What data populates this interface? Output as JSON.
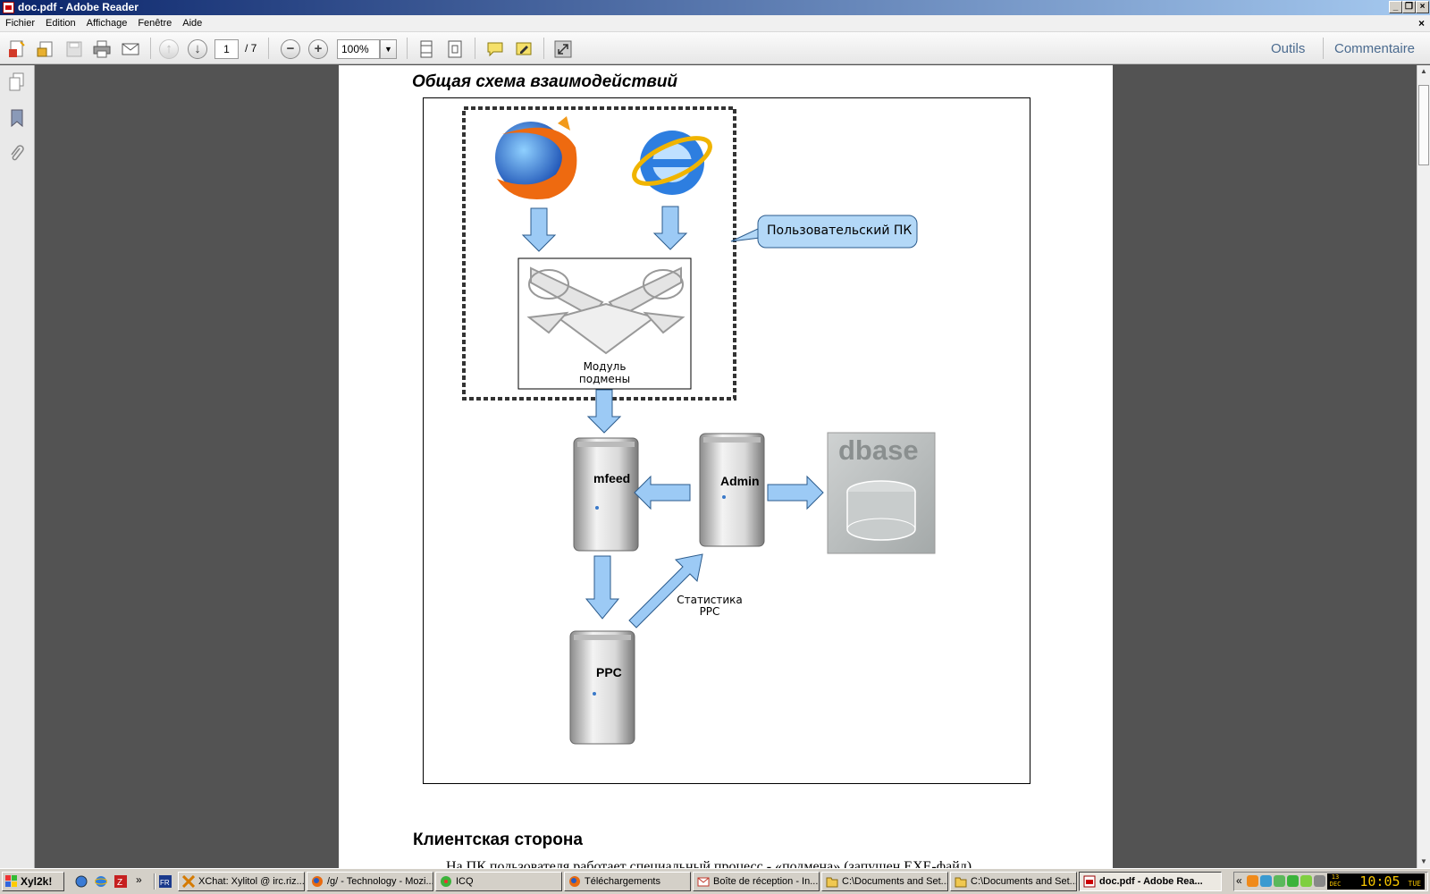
{
  "window": {
    "title": "doc.pdf - Adobe Reader"
  },
  "menu": [
    "Fichier",
    "Edition",
    "Affichage",
    "Fenêtre",
    "Aide"
  ],
  "toolbar": {
    "page_current": "1",
    "page_total": "/ 7",
    "zoom": "100%",
    "tools_label": "Outils",
    "comment_label": "Commentaire"
  },
  "document": {
    "heading": "Общая схема взаимодействий",
    "diagram": {
      "callout": "Пользовательский ПК",
      "module_label_line1": "Модуль",
      "module_label_line2": "подмены",
      "server_mfeed": "mfeed",
      "server_admin": "Admin",
      "server_ppc": "PPC",
      "db_label": "dbase",
      "stats_line1": "Статистика",
      "stats_line2": "PPC"
    },
    "section_heading": "Клиентская сторона",
    "body_text": "На ПК пользователя работает специальный процесс - «подмена» (запущен EXE-файл)"
  },
  "taskbar": {
    "start": "Xyl2k!",
    "tasks": [
      "XChat: Xylitol @ irc.riz...",
      "/g/ - Technology - Mozi...",
      "ICQ",
      "Téléchargements",
      "Boîte de réception - In...",
      "C:\\Documents and Set...",
      "C:\\Documents and Set...",
      "doc.pdf - Adobe Rea..."
    ],
    "clock": "10:05",
    "date_day": "13",
    "date_month": "DEC",
    "weekday": "TUE"
  },
  "colors": {
    "title_gradient_start": "#0a246a",
    "arrow_fill": "#9ccaf5",
    "accent_link": "#4b6b8f"
  }
}
